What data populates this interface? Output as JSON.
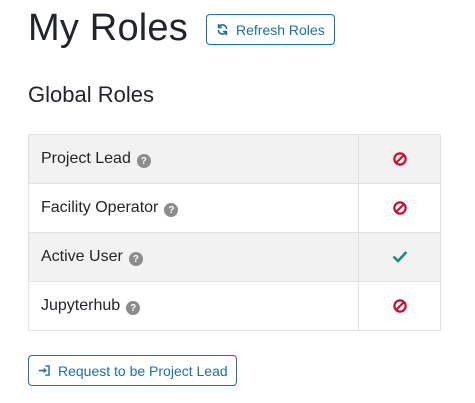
{
  "header": {
    "title": "My Roles",
    "refresh_label": "Refresh Roles"
  },
  "global_roles": {
    "title": "Global Roles",
    "rows": [
      {
        "label": "Project Lead",
        "granted": false,
        "status_icon": "ban-icon"
      },
      {
        "label": "Facility Operator",
        "granted": false,
        "status_icon": "ban-icon"
      },
      {
        "label": "Active User",
        "granted": true,
        "status_icon": "check-icon"
      },
      {
        "label": "Jupyterhub",
        "granted": false,
        "status_icon": "ban-icon"
      }
    ]
  },
  "request_button": {
    "label": "Request to be Project Lead"
  },
  "colors": {
    "accent": "#1d6fa5",
    "denied": "#c8102e",
    "granted": "#1a8f7a",
    "help": "#8c8c8c"
  }
}
